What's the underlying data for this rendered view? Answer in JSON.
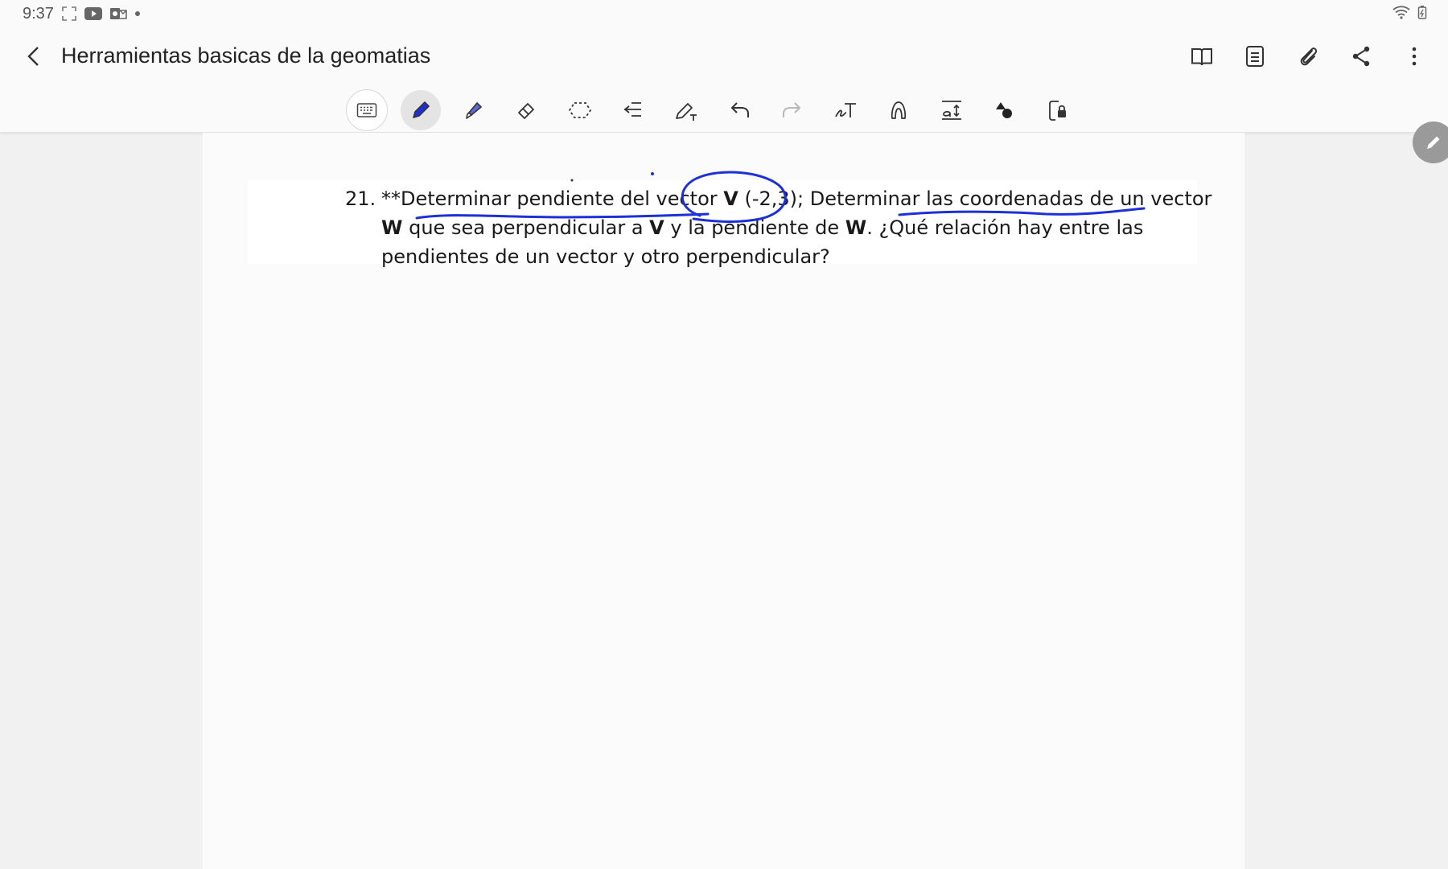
{
  "status_bar": {
    "time": "9:37"
  },
  "app_bar": {
    "title": "Herramientas basicas de la geomatias"
  },
  "toolbar": {
    "tools": [
      "keyboard-icon",
      "pen-icon",
      "highlighter-icon",
      "eraser-icon",
      "lasso-icon",
      "text-align-icon",
      "pen-to-text-icon",
      "undo-icon",
      "redo-icon",
      "handwriting-to-text-icon",
      "shape-icon",
      "text-size-icon",
      "insert-shapes-icon",
      "page-lock-icon"
    ],
    "active_tool": "pen-icon"
  },
  "question": {
    "number": "21.",
    "line1": {
      "prefix": "**Determinar pendiente del vector ",
      "vector_v": "V",
      "coords": " (-2,3); Determinar las coordenadas de un vector"
    },
    "line2": {
      "vector_w": "W",
      "text_a": " que sea perpendicular a ",
      "vector_v": "V",
      "text_b": " y la pendiente de ",
      "vector_w2": "W",
      "text_c": ".  ¿Qué relación hay entre las"
    },
    "line3": "pendientes de un vector y otro perpendicular?"
  },
  "colors": {
    "ink": "#1d2fd8",
    "background": "#f1f1f1",
    "page": "#fbfbfb"
  }
}
